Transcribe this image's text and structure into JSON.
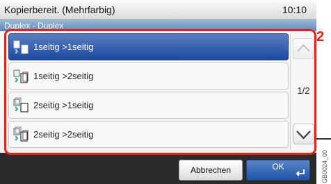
{
  "status": {
    "message": "Kopierbereit. (Mehrfarbig)",
    "time": "10:10"
  },
  "screen_title": "Duplex - Duplex",
  "options": [
    {
      "label": "1seitig >1seitig",
      "selected": true,
      "icon": "duplex-1to1-icon"
    },
    {
      "label": "1seitig >2seitig",
      "selected": false,
      "icon": "duplex-1to2-icon"
    },
    {
      "label": "2seitig >1seitig",
      "selected": false,
      "icon": "duplex-2to1-icon"
    },
    {
      "label": "2seitig >2seitig",
      "selected": false,
      "icon": "duplex-2to2-icon"
    }
  ],
  "pager": {
    "indicator": "1/2"
  },
  "buttons": {
    "cancel": "Abbrechen",
    "ok": "OK"
  },
  "callout": {
    "number": "2"
  },
  "figure_code": "GB0024_00",
  "colors": {
    "accent": "#1c48a0",
    "highlight": "#e2231a",
    "subtitle_bar": "#5f86b7"
  }
}
